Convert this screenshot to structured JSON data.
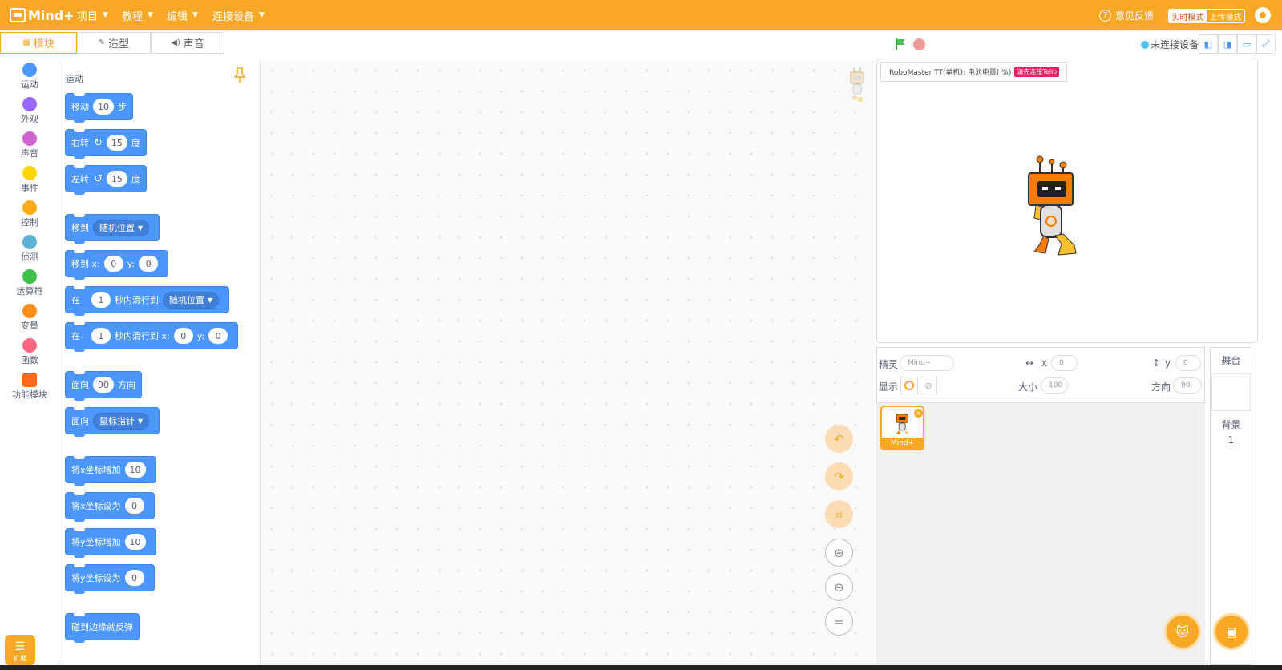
{
  "app": {
    "logo_text": "Mind+"
  },
  "menubar": {
    "items": [
      {
        "label": "项目"
      },
      {
        "label": "教程"
      },
      {
        "label": "编辑"
      },
      {
        "label": "连接设备"
      }
    ],
    "feedback": "意见反馈",
    "mode_realtime": "实时模式",
    "mode_upload": "上传模式",
    "color": "#f9a825"
  },
  "tabs": [
    {
      "label": "模块",
      "icon": "blocks-icon"
    },
    {
      "label": "造型",
      "icon": "brush-icon"
    },
    {
      "label": "声音",
      "icon": "speaker-icon"
    }
  ],
  "stage_header": {
    "device_status": "未连接设备"
  },
  "categories": [
    {
      "label": "运动",
      "color": "#4c97ff"
    },
    {
      "label": "外观",
      "color": "#9966ff"
    },
    {
      "label": "声音",
      "color": "#cf63cf"
    },
    {
      "label": "事件",
      "color": "#ffd500"
    },
    {
      "label": "控制",
      "color": "#ffab19"
    },
    {
      "label": "侦测",
      "color": "#5cb1d6"
    },
    {
      "label": "运算符",
      "color": "#40bf4a"
    },
    {
      "label": "变量",
      "color": "#ff8c1a"
    },
    {
      "label": "函数",
      "color": "#ff6680"
    },
    {
      "label": "功能模块",
      "color": "#ff6a1a"
    }
  ],
  "extension_label": "扩展",
  "palette": {
    "title": "运动",
    "blocks": {
      "move": {
        "label": "移动",
        "steps": "10",
        "unit": "步"
      },
      "turn_right": {
        "label": "右转",
        "deg": "15",
        "unit": "度"
      },
      "turn_left": {
        "label": "左转",
        "deg": "15",
        "unit": "度"
      },
      "goto": {
        "label": "移到",
        "target": "随机位置"
      },
      "goto_xy": {
        "label": "移到 x:",
        "x": "0",
        "ylabel": "y:",
        "y": "0"
      },
      "glide": {
        "label": "在",
        "secs": "1",
        "mid": "秒内滑行到",
        "target": "随机位置"
      },
      "glide_xy": {
        "label": "在",
        "secs": "1",
        "mid": "秒内滑行到 x:",
        "x": "0",
        "ylabel": "y:",
        "y": "0"
      },
      "point_dir": {
        "label": "面向",
        "dir": "90",
        "unit": "方向"
      },
      "point_towards": {
        "label": "面向",
        "target": "鼠标指针"
      },
      "change_x": {
        "label": "将x坐标增加",
        "val": "10"
      },
      "set_x": {
        "label": "将x坐标设为",
        "val": "0"
      },
      "change_y": {
        "label": "将y坐标增加",
        "val": "10"
      },
      "set_y": {
        "label": "将y坐标设为",
        "val": "0"
      },
      "bounce": {
        "label": "碰到边缘就反弹"
      }
    }
  },
  "stage": {
    "info_text": "RoboMaster TT(单机): 电池电量( %)",
    "tello_badge": "请先连接Tello"
  },
  "sprite_info": {
    "sprite_label": "精灵",
    "sprite_name": "Mind+",
    "x_label": "x",
    "x": "0",
    "y_label": "y",
    "y": "0",
    "show_label": "显示",
    "size_label": "大小",
    "size": "100",
    "dir_label": "方向",
    "dir": "90"
  },
  "sprites": [
    {
      "name": "Mind+"
    }
  ],
  "stage_panel": {
    "title": "舞台",
    "bg_label": "背景",
    "bg_count": "1"
  }
}
